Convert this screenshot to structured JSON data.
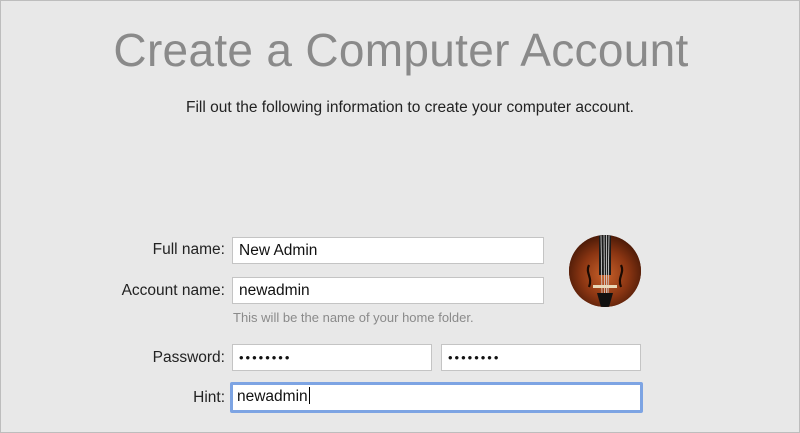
{
  "header": {
    "title": "Create a Computer Account",
    "subtitle": "Fill out the following information to create your computer account."
  },
  "form": {
    "full_name": {
      "label": "Full name:",
      "value": "New Admin"
    },
    "account_name": {
      "label": "Account name:",
      "value": "newadmin",
      "helper": "This will be the name of your home folder."
    },
    "password": {
      "label": "Password:",
      "value": "••••••••",
      "verify_value": "••••••••"
    },
    "hint": {
      "label": "Hint:",
      "value": "newadmin"
    }
  },
  "avatar": {
    "icon": "violin-icon"
  },
  "colors": {
    "focus_ring": "#7da4e3",
    "background": "#e8e8e8",
    "title": "#8a8a8a"
  }
}
